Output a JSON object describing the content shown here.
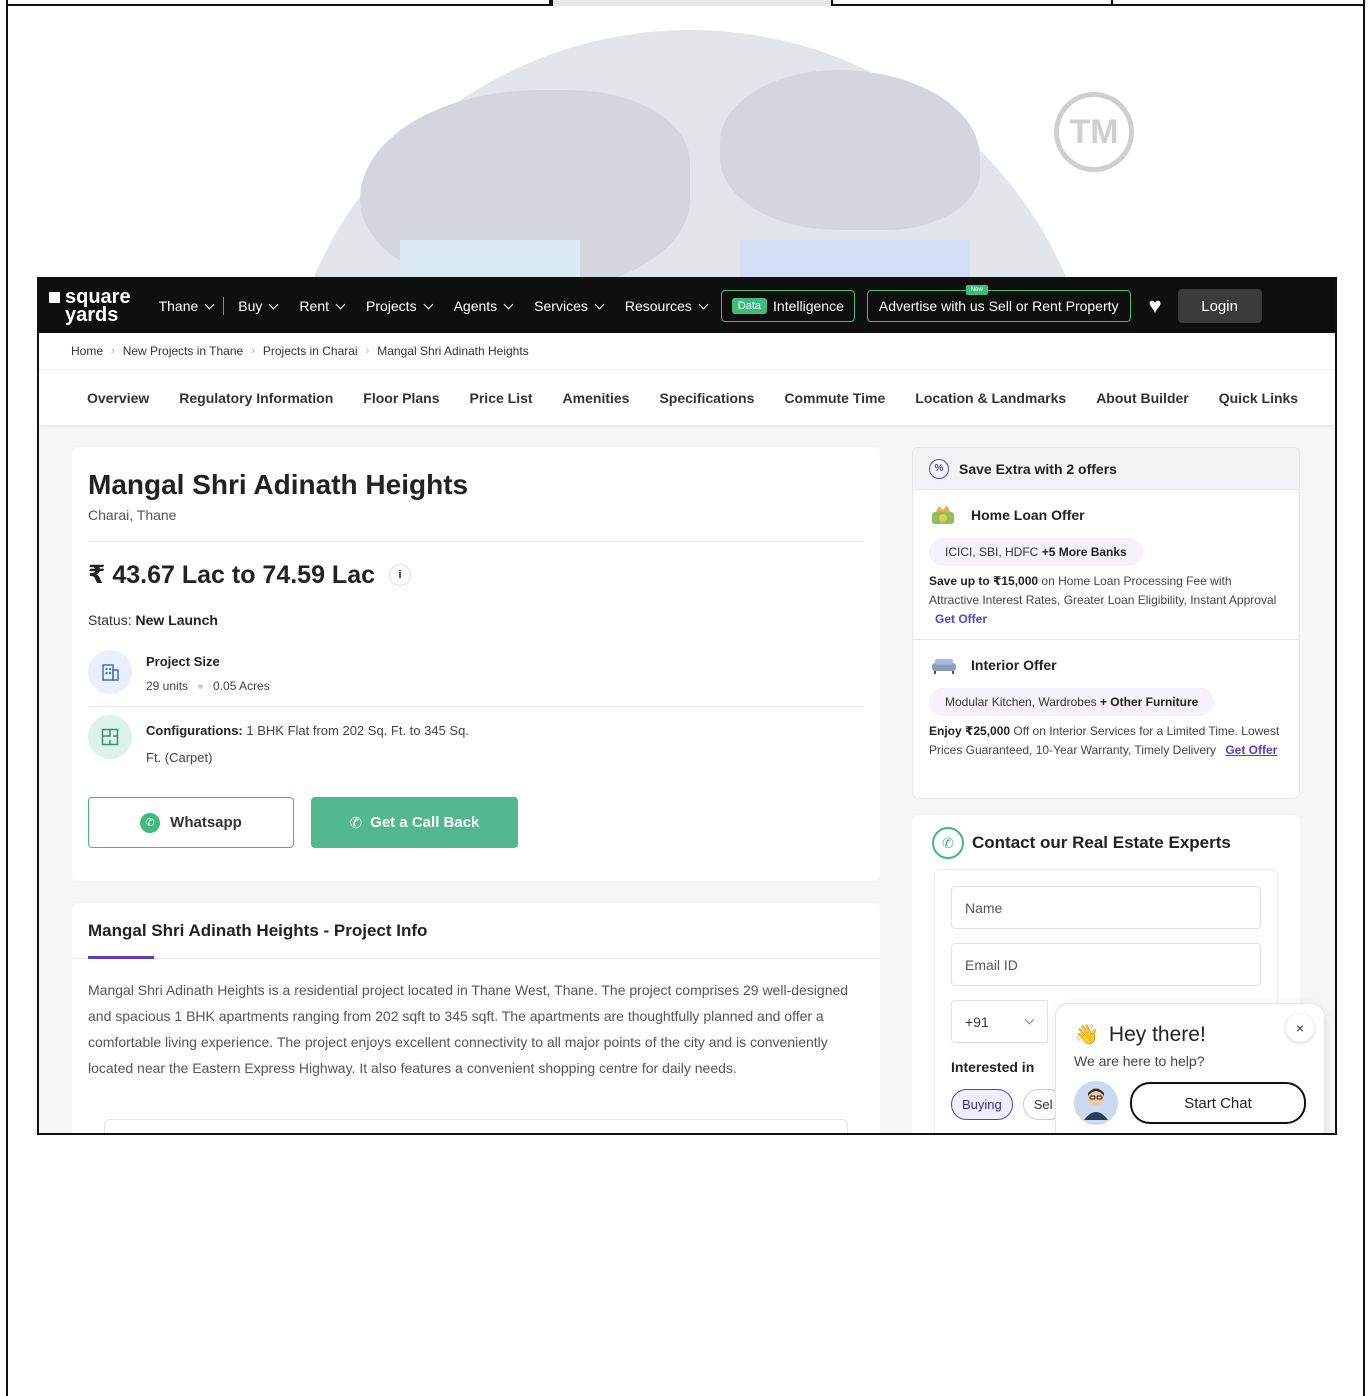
{
  "nav": {
    "logo_top": "square",
    "logo_bottom": "yards",
    "items": [
      {
        "label": "Thane"
      },
      {
        "label": "Buy"
      },
      {
        "label": "Rent"
      },
      {
        "label": "Projects"
      },
      {
        "label": "Agents"
      },
      {
        "label": "Services"
      },
      {
        "label": "Resources"
      }
    ],
    "data_pill": "Data",
    "data_label": "Intelligence",
    "advertise_label": "Advertise with us",
    "sell_label": "Sell or Rent Property",
    "new_tag": "New",
    "login_label": "Login"
  },
  "breadcrumb": [
    "Home",
    "New Projects in Thane",
    "Projects in Charai",
    "Mangal Shri Adinath Heights"
  ],
  "tabs": [
    "Overview",
    "Regulatory Information",
    "Floor Plans",
    "Price List",
    "Amenities",
    "Specifications",
    "Commute Time",
    "Location & Landmarks",
    "About Builder",
    "Quick Links"
  ],
  "project": {
    "title": "Mangal Shri Adinath Heights",
    "location": "Charai, Thane",
    "price": "₹ 43.67 Lac to 74.59 Lac",
    "status_label": "Status:",
    "status_value": "New Launch",
    "size_title": "Project Size",
    "units": "29 units",
    "acres": "0.05 Acres",
    "config_label": "Configurations:",
    "config_value": "1 BHK Flat from 202 Sq. Ft. to 345 Sq. Ft. (Carpet)",
    "whatsapp_label": "Whatsapp",
    "callback_label": "Get a Call Back"
  },
  "info": {
    "title": "Mangal Shri Adinath Heights - Project Info",
    "body": "Mangal Shri Adinath Heights is a residential project located in Thane West, Thane. The project comprises 29 well-designed and spacious 1 BHK apartments ranging from 202 sqft to 345 sqft. The apartments are thoughtfully planned and offer a comfortable living experience. The project enjoys excellent connectivity to all major points of the city and is conveniently located near the Eastern Express Highway. It also features a convenient shopping centre for daily needs."
  },
  "offers": {
    "header": "Save Extra with 2 offers",
    "home_loan": {
      "title": "Home Loan Offer",
      "chip_text": "ICICI, SBI, HDFC",
      "chip_bold": "+5 More Banks",
      "lead_bold": "Save up to ₹15,000",
      "text": "on Home Loan Processing Fee with Attractive Interest Rates, Greater Loan Eligibility, Instant Approval",
      "link": "Get Offer"
    },
    "interior": {
      "title": "Interior Offer",
      "chip_text": "Modular Kitchen, Wardrobes",
      "chip_bold": "+ Other Furniture",
      "lead_bold": "Enjoy ₹25,000",
      "text": "Off on Interior Services for a Limited Time. Lowest Prices Guaranteed, 10-Year Warranty, Timely Delivery",
      "link": "Get Offer"
    }
  },
  "contact": {
    "title": "Contact our Real Estate Experts",
    "name_placeholder": "Name",
    "email_placeholder": "Email ID",
    "country_code": "+91",
    "interested_label": "Interested in",
    "chips": [
      "Buying",
      "Sel"
    ]
  },
  "chat": {
    "hey": "Hey there!",
    "sub": "We are here to help?",
    "start": "Start Chat",
    "close": "×"
  },
  "watermark": "TM",
  "colors": {
    "accent_green": "#3dbd7d",
    "accent_purple": "#5b3fc4",
    "nav_bg": "#0f0f10"
  }
}
